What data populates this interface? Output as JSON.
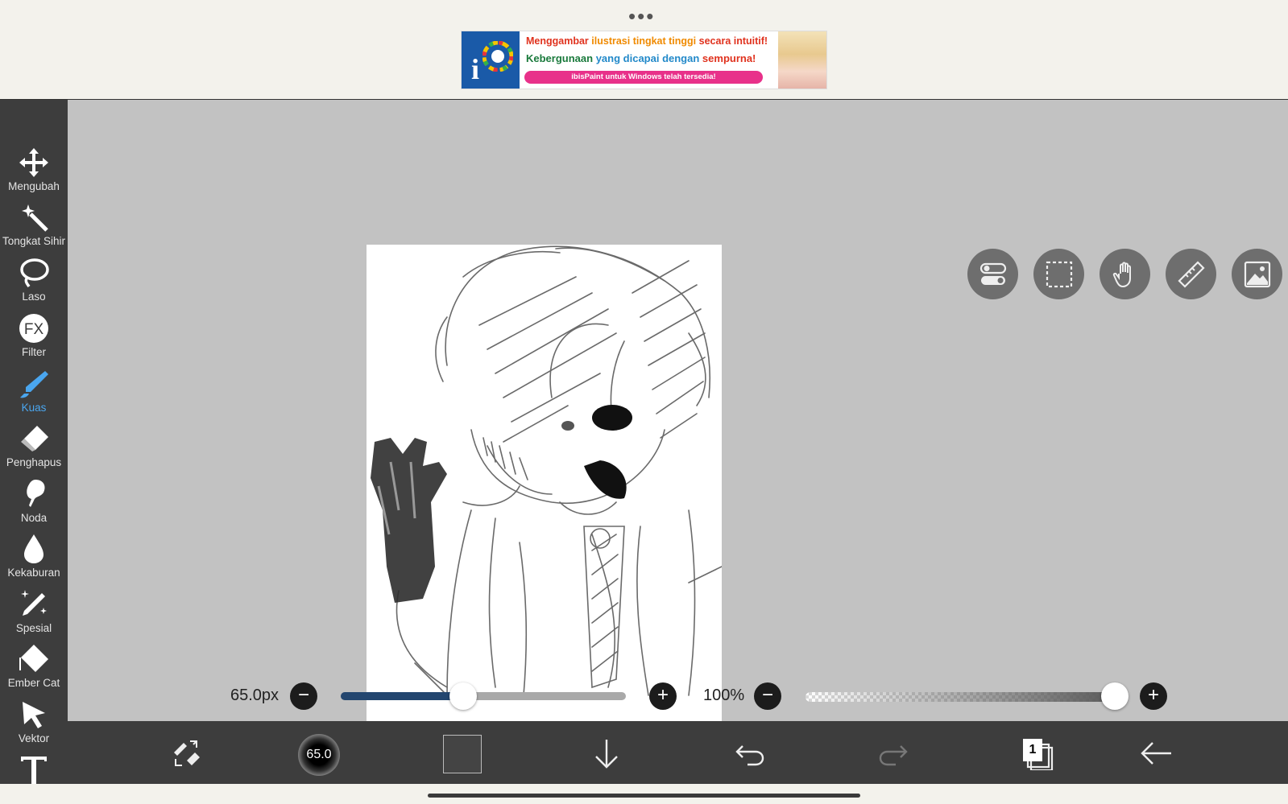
{
  "topbar": {
    "menu_dots": "•••",
    "ad": {
      "line1_a": "Menggambar",
      "line1_b": "ilustrasi tingkat tinggi",
      "line1_c": "secara intuitif!",
      "line2_a": "Kebergunaan",
      "line2_b": "yang dicapai dengan",
      "line2_c": "sempurna!",
      "cta": "ibisPaint untuk Windows telah tersedia!",
      "logo_letter": "i"
    }
  },
  "toolbar": {
    "tools": [
      {
        "label": "Mengubah",
        "icon": "move-icon"
      },
      {
        "label": "Tongkat Sihir",
        "icon": "magic-wand-icon"
      },
      {
        "label": "Laso",
        "icon": "lasso-icon"
      },
      {
        "label": "Filter",
        "icon": "fx-icon",
        "icon_text": "FX"
      },
      {
        "label": "Kuas",
        "icon": "brush-icon",
        "active": true
      },
      {
        "label": "Penghapus",
        "icon": "eraser-icon"
      },
      {
        "label": "Noda",
        "icon": "smudge-icon"
      },
      {
        "label": "Kekaburan",
        "icon": "blur-drop-icon"
      },
      {
        "label": "Spesial",
        "icon": "special-pen-icon"
      },
      {
        "label": "Ember Cat",
        "icon": "paint-bucket-icon"
      },
      {
        "label": "Vektor",
        "icon": "vector-arrow-icon"
      }
    ]
  },
  "brush": {
    "size_label": "65.0px",
    "size_fraction": 0.43,
    "opacity_label": "100%",
    "opacity_fraction": 1.0,
    "preview_label": "65.0"
  },
  "bottombar": {
    "layer_count": "1"
  },
  "colors": {
    "accent": "#4aa6ef",
    "toolbar_bg": "#3d3d3d",
    "workspace_bg": "#c2c2c2",
    "slider_fill": "#23466f",
    "current_color": "#444444"
  }
}
